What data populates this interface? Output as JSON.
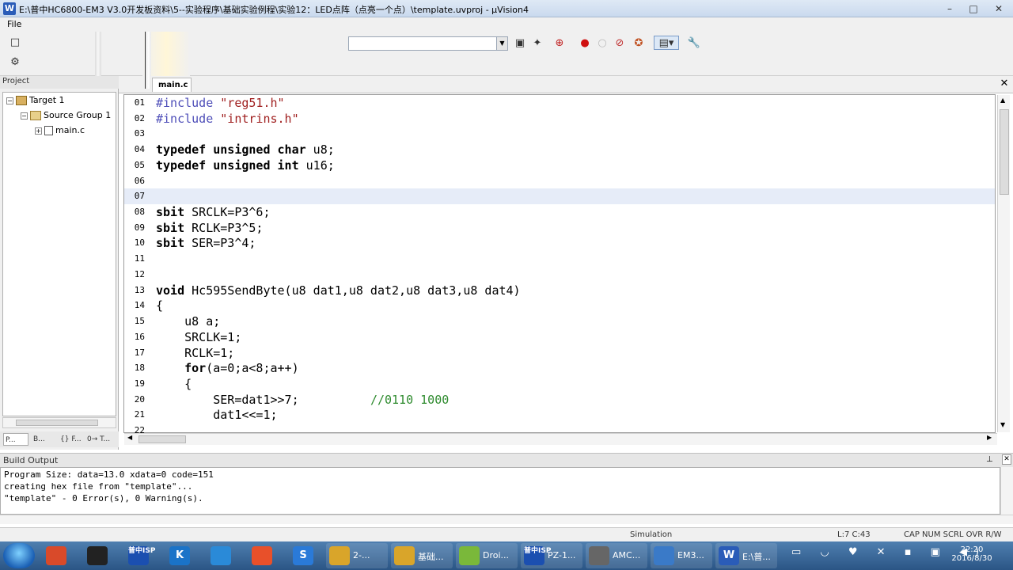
{
  "window": {
    "title": "E:\\普中HC6800-EM3 V3.0开发板资料\\5--实验程序\\基础实验例程\\实验12：LED点阵（点亮一个点）\\template.uvproj - µVision4",
    "app_icon": "W",
    "min_label": "–",
    "max_label": "□",
    "close_label": "✕"
  },
  "menu": {
    "file": "File"
  },
  "project": {
    "header": "Project",
    "tree": [
      {
        "label": "Target 1",
        "icon": "target-icon"
      },
      {
        "label": "Source Group 1",
        "icon": "folder-icon"
      },
      {
        "label": "main.c",
        "icon": "file-icon"
      }
    ],
    "tabs": [
      "P...",
      "B...",
      "{} F...",
      "0→ T..."
    ]
  },
  "editor": {
    "tab": "main.c",
    "close_label": "✕",
    "lines": [
      {
        "n": "01",
        "parts": [
          [
            "pp",
            "#include "
          ],
          [
            "str",
            "\"reg51.h\""
          ]
        ]
      },
      {
        "n": "02",
        "parts": [
          [
            "pp",
            "#include "
          ],
          [
            "str",
            "\"intrins.h\""
          ]
        ]
      },
      {
        "n": "03",
        "parts": []
      },
      {
        "n": "04",
        "parts": [
          [
            "kw",
            "typedef unsigned char"
          ],
          [
            "nm",
            " u8;"
          ]
        ]
      },
      {
        "n": "05",
        "parts": [
          [
            "kw",
            "typedef unsigned int"
          ],
          [
            "nm",
            " u16;"
          ]
        ]
      },
      {
        "n": "06",
        "parts": []
      },
      {
        "n": "07",
        "parts": [],
        "highlight": true
      },
      {
        "n": "08",
        "parts": [
          [
            "kw",
            "sbit"
          ],
          [
            "nm",
            " SRCLK=P3^6;"
          ]
        ]
      },
      {
        "n": "09",
        "parts": [
          [
            "kw",
            "sbit"
          ],
          [
            "nm",
            " RCLK=P3^5;"
          ]
        ]
      },
      {
        "n": "10",
        "parts": [
          [
            "kw",
            "sbit"
          ],
          [
            "nm",
            " SER=P3^4;"
          ]
        ]
      },
      {
        "n": "11",
        "parts": []
      },
      {
        "n": "12",
        "parts": []
      },
      {
        "n": "13",
        "parts": [
          [
            "kw",
            "void"
          ],
          [
            "nm",
            " Hc595SendByte(u8 dat1,u8 dat2,u8 dat3,u8 dat4)"
          ]
        ]
      },
      {
        "n": "14",
        "parts": [
          [
            "nm",
            "{"
          ]
        ]
      },
      {
        "n": "15",
        "parts": [
          [
            "nm",
            "    u8 a;"
          ]
        ]
      },
      {
        "n": "16",
        "parts": [
          [
            "nm",
            "    SRCLK=1;"
          ]
        ]
      },
      {
        "n": "17",
        "parts": [
          [
            "nm",
            "    RCLK=1;"
          ]
        ]
      },
      {
        "n": "18",
        "parts": [
          [
            "kw",
            "    for"
          ],
          [
            "nm",
            "(a=0;a<8;a++)"
          ]
        ]
      },
      {
        "n": "19",
        "parts": [
          [
            "nm",
            "    {"
          ]
        ]
      },
      {
        "n": "20",
        "parts": [
          [
            "nm",
            "        SER=dat1>>7;          "
          ],
          [
            "cm",
            "//0110 1000"
          ]
        ]
      },
      {
        "n": "21",
        "parts": [
          [
            "nm",
            "        dat1<<=1;"
          ]
        ]
      },
      {
        "n": "22",
        "parts": []
      }
    ]
  },
  "build_output": {
    "header": "Build Output",
    "lines": [
      "Program Size: data=13.0 xdata=0 code=151",
      "creating hex file from \"template\"...",
      "\"template\" - 0 Error(s), 0 Warning(s)."
    ]
  },
  "status": {
    "mode": "Simulation",
    "position": "L:7 C:43",
    "indicators": "CAP  NUM  SCRL  OVR  R/W"
  },
  "taskbar": {
    "items": [
      {
        "label": "",
        "icon": "pig-icon",
        "color": "#d94a2a"
      },
      {
        "label": "",
        "icon": "qq-icon",
        "color": "#222222"
      },
      {
        "label": "",
        "icon": "isp-icon",
        "text": "普中ISP",
        "color": "#1b4fb0"
      },
      {
        "label": "",
        "icon": "k-icon",
        "text": "K",
        "color": "#1a73c8"
      },
      {
        "label": "",
        "icon": "share-icon",
        "color": "#2a8ad8"
      },
      {
        "label": "",
        "icon": "play-icon",
        "color": "#e8502a"
      },
      {
        "label": "",
        "icon": "s-icon",
        "text": "S",
        "color": "#2a7ad8"
      },
      {
        "label": "2-...",
        "icon": "folder-icon",
        "color": "#d9a52a"
      },
      {
        "label": "基础...",
        "icon": "folder-icon",
        "color": "#d9a52a"
      },
      {
        "label": "Droi...",
        "icon": "android-icon",
        "color": "#7ab83a"
      },
      {
        "label": "PZ-1...",
        "icon": "isp-icon",
        "text": "普中ISP",
        "color": "#1b4fb0"
      },
      {
        "label": "AMC...",
        "icon": "amc-icon",
        "color": "#666666"
      },
      {
        "label": "EM3...",
        "icon": "em3-icon",
        "color": "#3a7ac8"
      },
      {
        "label": "E:\\普...",
        "icon": "uvision-icon",
        "text": "W",
        "color": "#2a5cb8"
      }
    ],
    "time": "22:20",
    "date": "2016/8/30"
  }
}
